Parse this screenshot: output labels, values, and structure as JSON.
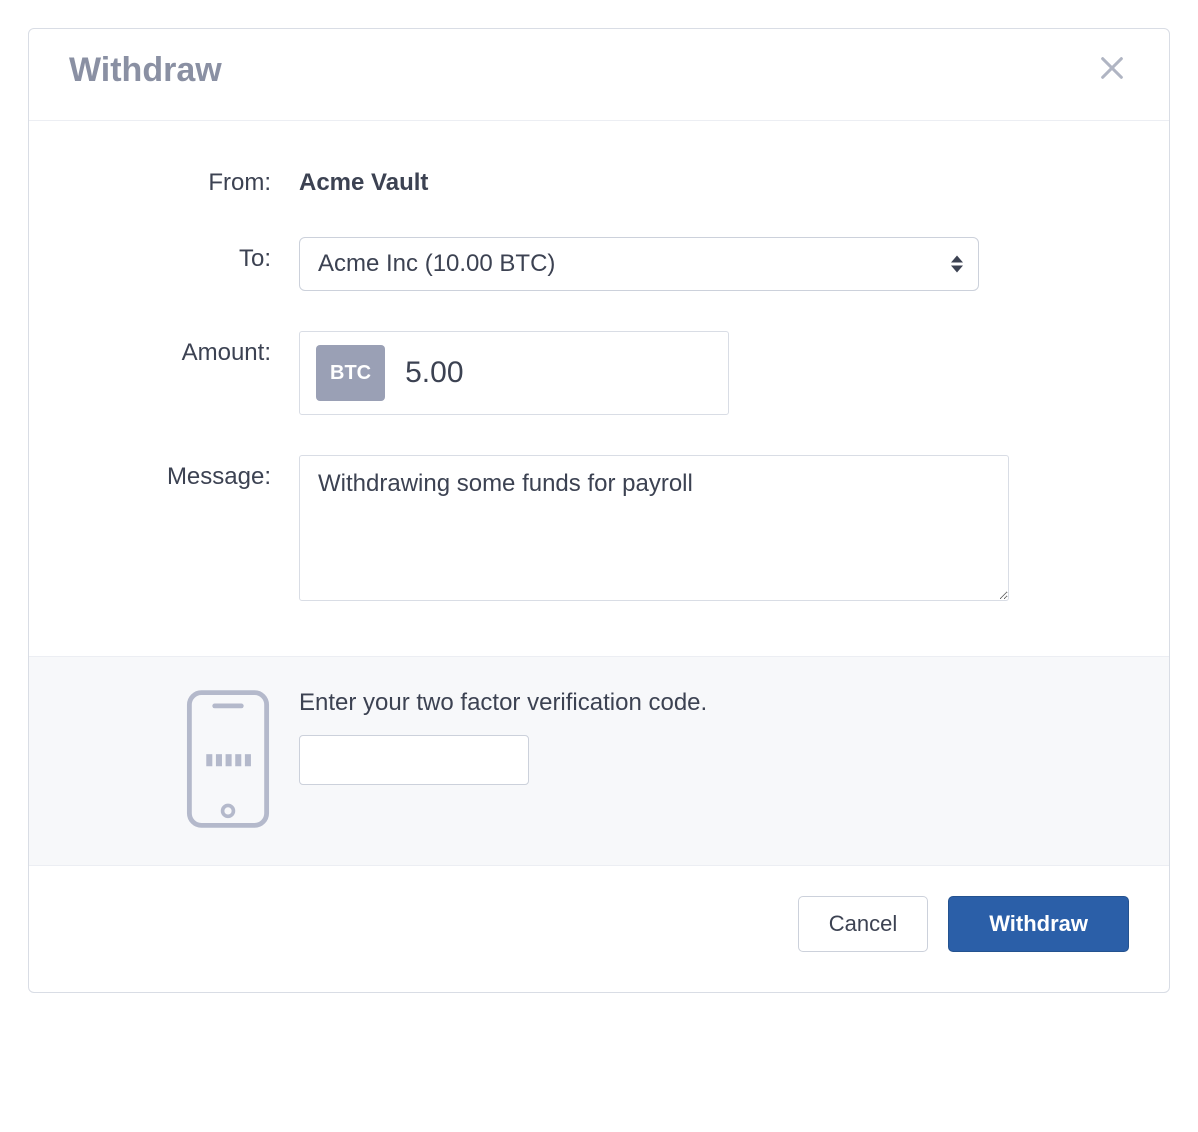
{
  "modal": {
    "title": "Withdraw"
  },
  "form": {
    "labels": {
      "from": "From:",
      "to": "To:",
      "amount": "Amount:",
      "message": "Message:"
    },
    "from_value": "Acme Vault",
    "to_selected": "Acme Inc (10.00 BTC)",
    "amount": {
      "currency_badge": "BTC",
      "value": "5.00"
    },
    "message_value": "Withdrawing some funds for payroll"
  },
  "twofa": {
    "prompt": "Enter your two factor verification code.",
    "code_value": ""
  },
  "footer": {
    "cancel_label": "Cancel",
    "submit_label": "Withdraw"
  }
}
